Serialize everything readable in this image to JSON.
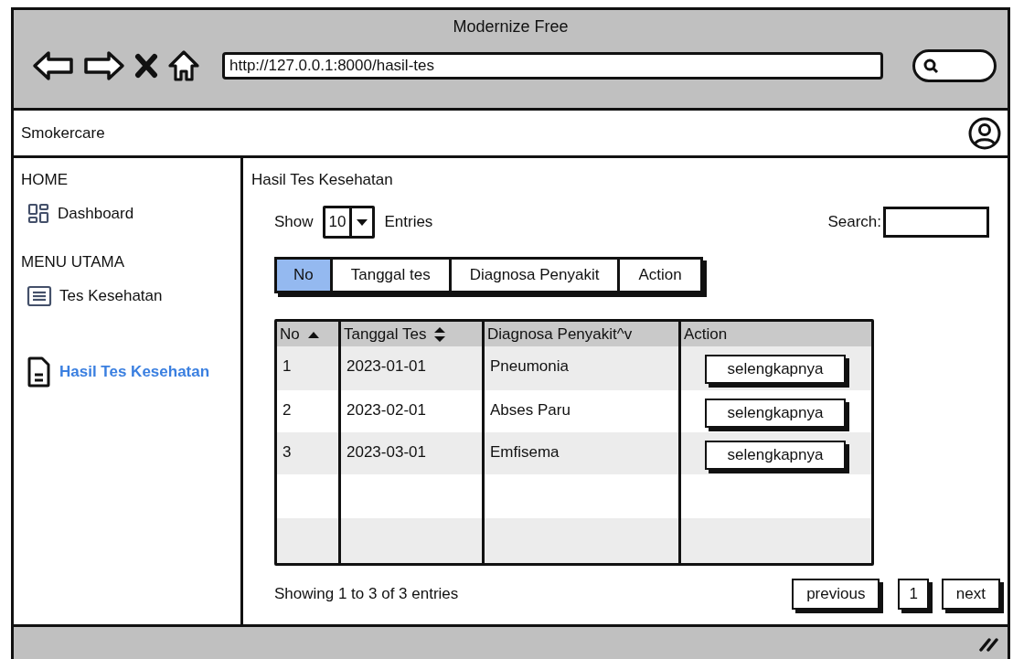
{
  "window": {
    "title": "Modernize Free"
  },
  "browser": {
    "url": "http://127.0.0.1:8000/hasil-tes"
  },
  "header": {
    "brand": "Smokercare"
  },
  "sidebar": {
    "sections": [
      {
        "heading": "HOME",
        "items": [
          {
            "label": "Dashboard",
            "kind": "dashboard",
            "selected": false
          }
        ]
      },
      {
        "heading": "MENU UTAMA",
        "items": [
          {
            "label": "Tes Kesehatan",
            "kind": "list",
            "selected": false
          },
          {
            "label": "Hasil Tes Kesehatan",
            "kind": "document",
            "selected": true
          }
        ]
      }
    ]
  },
  "content": {
    "title": "Hasil Tes Kesehatan",
    "length": {
      "label_before": "Show",
      "value": "10",
      "label_after": "Entries"
    },
    "search": {
      "label": "Search:"
    },
    "column_tabs": [
      {
        "label": "No",
        "selected": true
      },
      {
        "label": "Tanggal tes",
        "selected": false
      },
      {
        "label": "Diagnosa Penyakit",
        "selected": false
      },
      {
        "label": "Action",
        "selected": false
      }
    ],
    "table": {
      "columns": [
        {
          "label": "No",
          "kind": "ascending"
        },
        {
          "label": "Tanggal Tes",
          "kind": "sortable"
        },
        {
          "label": "Diagnosa Penyakit^v",
          "kind": "plain"
        },
        {
          "label": "Action",
          "kind": "plain"
        }
      ],
      "rows": [
        {
          "no": "1",
          "date": "2023-01-01",
          "diagnosis": "Pneumonia",
          "action": "selengkapnya"
        },
        {
          "no": "2",
          "date": "2023-02-01",
          "diagnosis": "Abses Paru",
          "action": "selengkapnya"
        },
        {
          "no": "3",
          "date": "2023-03-01",
          "diagnosis": "Emfisema",
          "action": "selengkapnya"
        }
      ]
    },
    "info": "Showing 1 to 3 of 3 entries",
    "pagination": [
      {
        "label": "previous",
        "kind": "nav"
      },
      {
        "label": "1",
        "kind": "page"
      },
      {
        "label": "next",
        "kind": "nav"
      }
    ]
  }
}
